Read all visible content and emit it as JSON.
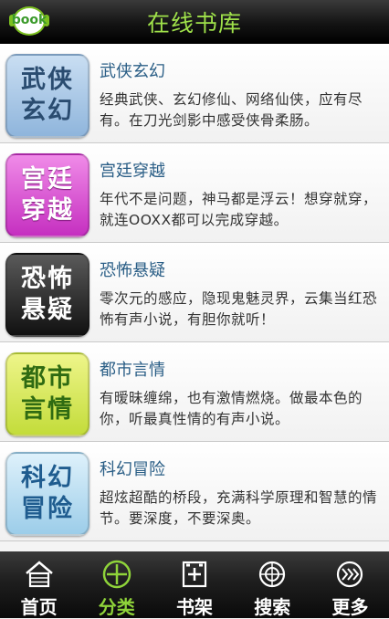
{
  "header": {
    "title": "在线书库",
    "logo_text": "book"
  },
  "categories": [
    {
      "name": "武侠玄幻",
      "thumb_text": [
        "武侠",
        "玄幻"
      ],
      "desc": "经典武侠、玄幻修仙、网络仙侠，应有尽有。在刀光剑影中感受侠骨柔肠。",
      "color": "#a9c7e6",
      "text_color": "#2a4c70"
    },
    {
      "name": "宫廷穿越",
      "thumb_text": [
        "宫廷",
        "穿越"
      ],
      "desc": "年代不是问题，神马都是浮云！想穿就穿，就连OOXX都可以完成穿越。",
      "color": "#e04fd8",
      "text_color": "#ffffff"
    },
    {
      "name": "恐怖悬疑",
      "thumb_text": [
        "恐怖",
        "悬疑"
      ],
      "desc": "零次元的感应，隐现鬼魅灵界，云集当红恐怖有声小说，有胆你就听！",
      "color": "#2b2b2b",
      "text_color": "#ffffff"
    },
    {
      "name": "都市言情",
      "thumb_text": [
        "都市",
        "言情"
      ],
      "desc": "有暧昧缠绵，也有激情燃烧。做最本色的你，听最真性情的有声小说。",
      "color": "#d4e85a",
      "text_color": "#2f6b12"
    },
    {
      "name": "科幻冒险",
      "thumb_text": [
        "科幻",
        "冒险"
      ],
      "desc": "超炫超酷的桥段，充满科学原理和智慧的情节。要深度，不要深奥。",
      "color": "#b5dcf2",
      "text_color": "#1f5c8f"
    }
  ],
  "tabs": [
    {
      "label": "首页",
      "icon": "home-icon"
    },
    {
      "label": "分类",
      "icon": "category-icon",
      "active": true
    },
    {
      "label": "书架",
      "icon": "bookshelf-icon"
    },
    {
      "label": "搜索",
      "icon": "search-icon"
    },
    {
      "label": "更多",
      "icon": "more-icon"
    }
  ],
  "colors": {
    "accent": "#8fd43a",
    "title": "#9fe14a",
    "item_title": "#2a5e86"
  }
}
